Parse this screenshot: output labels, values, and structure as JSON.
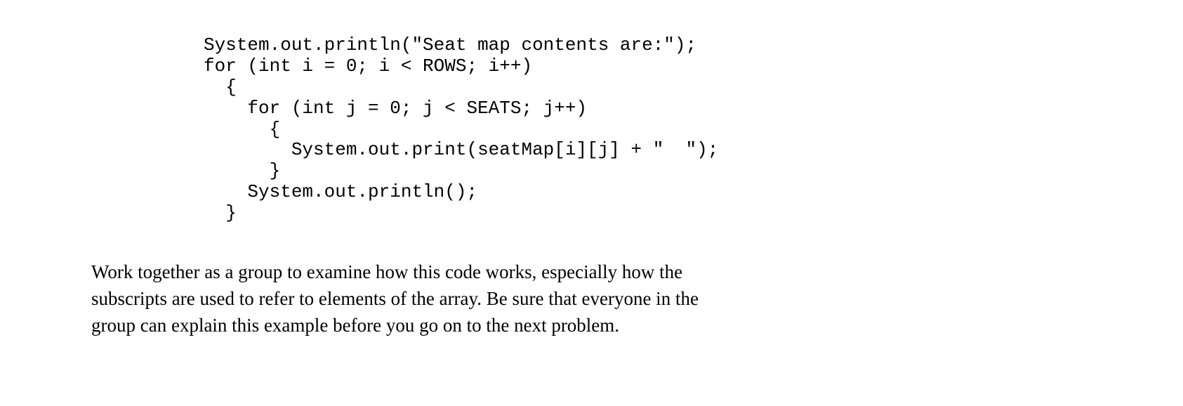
{
  "code": {
    "line1": "System.out.println(\"Seat map contents are:\");",
    "line2": "for (int i = 0; i < ROWS; i++)",
    "line3": "  {",
    "line4": "    for (int j = 0; j < SEATS; j++)",
    "line5": "      {",
    "line6": "        System.out.print(seatMap[i][j] + \"  \");",
    "line7": "      }",
    "line8": "    System.out.println();",
    "line9": "  }"
  },
  "paragraph": "Work together as a group to examine how this code works, especially how the subscripts are used to refer to elements of the array.  Be sure that everyone in the group can explain this example before you go on to the next problem."
}
